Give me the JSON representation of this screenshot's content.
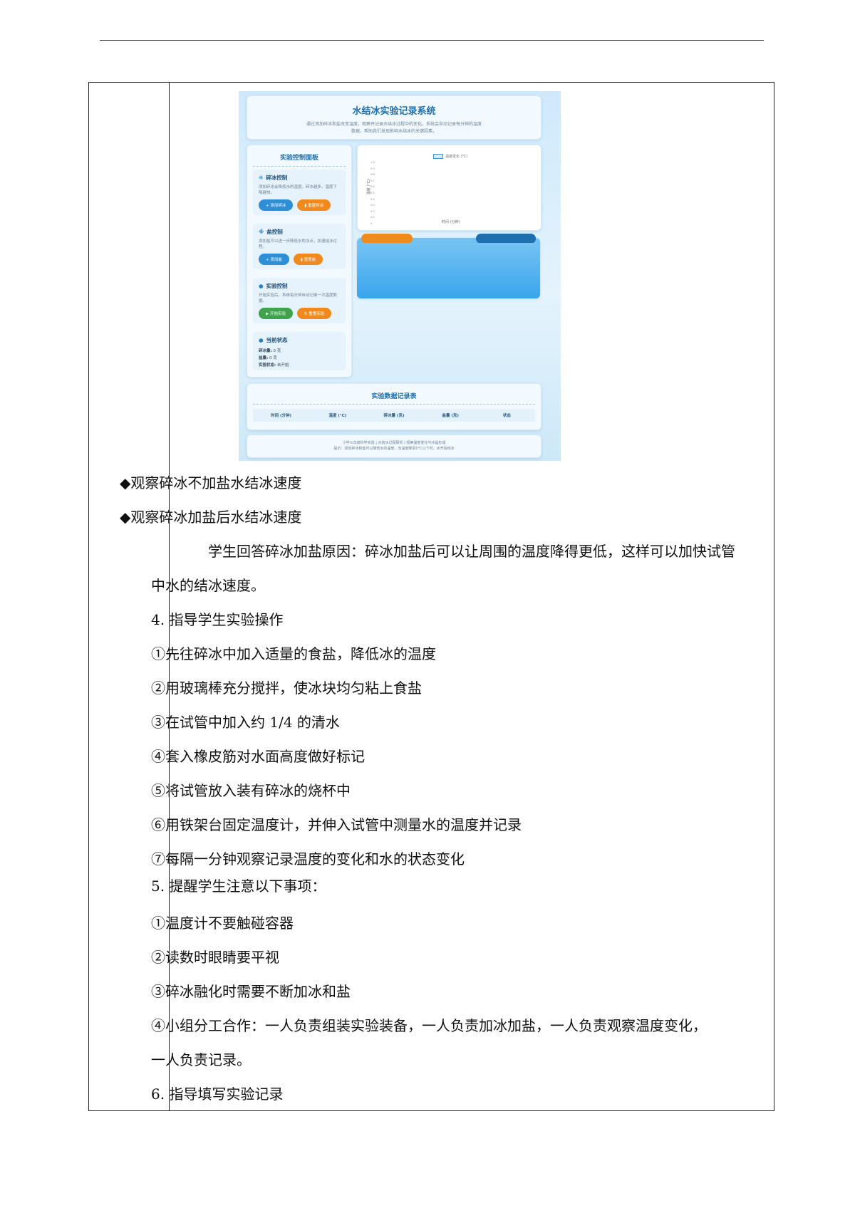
{
  "screenshot": {
    "title": "水结冰实验记录系统",
    "description": [
      "通过添加碎冰和盐改变温度，观察并记录水结冰过程中的变化。系统会自动记录每分钟的温度",
      "数据，帮助我们发现影响水结冰的关键因素。"
    ],
    "panel": {
      "title": "实验控制面板",
      "ice": {
        "icon": "snowflake-icon",
        "title": "碎冰控制",
        "desc": [
          "添加碎冰会降低水的温度。碎冰越多，温度下",
          "降越快。"
        ],
        "add": "+ 添加碎冰",
        "clear": "▮ 重置碎冰"
      },
      "salt": {
        "icon": "salt-icon",
        "title": "盐控制",
        "desc": [
          "添加盐可以进一步降低水的冰点，加速结冰过",
          "程。"
        ],
        "add": "+ 添加盐",
        "clear": "▮ 重置盐"
      },
      "experiment": {
        "icon": "timer-icon",
        "title": "实验控制",
        "desc": [
          "开始实验后，系统每分钟自动记录一次温度数",
          "据。"
        ],
        "start": "▶ 开始实验",
        "reset": "↻ 重置实验"
      },
      "status": {
        "icon": "info-icon",
        "title": "当前状态",
        "ice_label": "碎冰量:",
        "ice_value": "0 克",
        "salt_label": "盐量:",
        "salt_value": "0 克",
        "state_label": "实验状态:",
        "state_value": "未开始"
      }
    },
    "chart": {
      "legend": "温度变化 (°C)",
      "ylabel": "温度 (°C)",
      "xlabel": "时间 (分钟)",
      "yticks": [
        "1.0",
        "0.9",
        "0.8",
        "0.7",
        "0.6",
        "0.5",
        "0.4",
        "0.3",
        "0.2",
        "0.1",
        "0"
      ]
    },
    "table": {
      "title": "实验数据记录表",
      "headers": [
        "时间 (分钟)",
        "温度 (°C)",
        "碎冰量 (克)",
        "盐量 (克)",
        "状态"
      ]
    },
    "footer": [
      "小学三年级科学实验 | 水结冰过程探究 | 观察温度变化与冰晶形成",
      "提示：添加碎冰和盐可以降低水的温度，当温度降至0°C以下时，水开始结冰"
    ]
  },
  "body": {
    "bullet1": "◆观察碎冰不加盐水结冰速度",
    "bullet2": "◆观察碎冰加盐后水结冰速度",
    "answer_line1": "学生回答碎冰加盐原因：碎冰加盐后可以让周围的温度降得更低，这样可以加快试管",
    "answer_line2": "中水的结冰速度。",
    "step4_title": "4. 指导学生实验操作",
    "steps": [
      "①先往碎冰中加入适量的食盐，降低冰的温度",
      "②用玻璃棒充分搅拌，使冰块均匀粘上食盐",
      "③在试管中加入约 1/4 的清水",
      "④套入橡皮筋对水面高度做好标记",
      "⑤将试管放入装有碎冰的烧杯中",
      "⑥用铁架台固定温度计，并伸入试管中测量水的温度并记录",
      "⑦每隔一分钟观察记录温度的变化和水的状态变化"
    ],
    "step5_title": "5.  提醒学生注意以下事项：",
    "notes": [
      "①温度计不要触碰容器",
      "②读数时眼睛要平视",
      "③碎冰融化时需要不断加冰和盐",
      "④小组分工合作：一人负责组装实验装备，一人负责加冰加盐，一人负责观察温度变化，",
      "一人负责记录。"
    ],
    "step6_title": "6. 指导填写实验记录"
  }
}
